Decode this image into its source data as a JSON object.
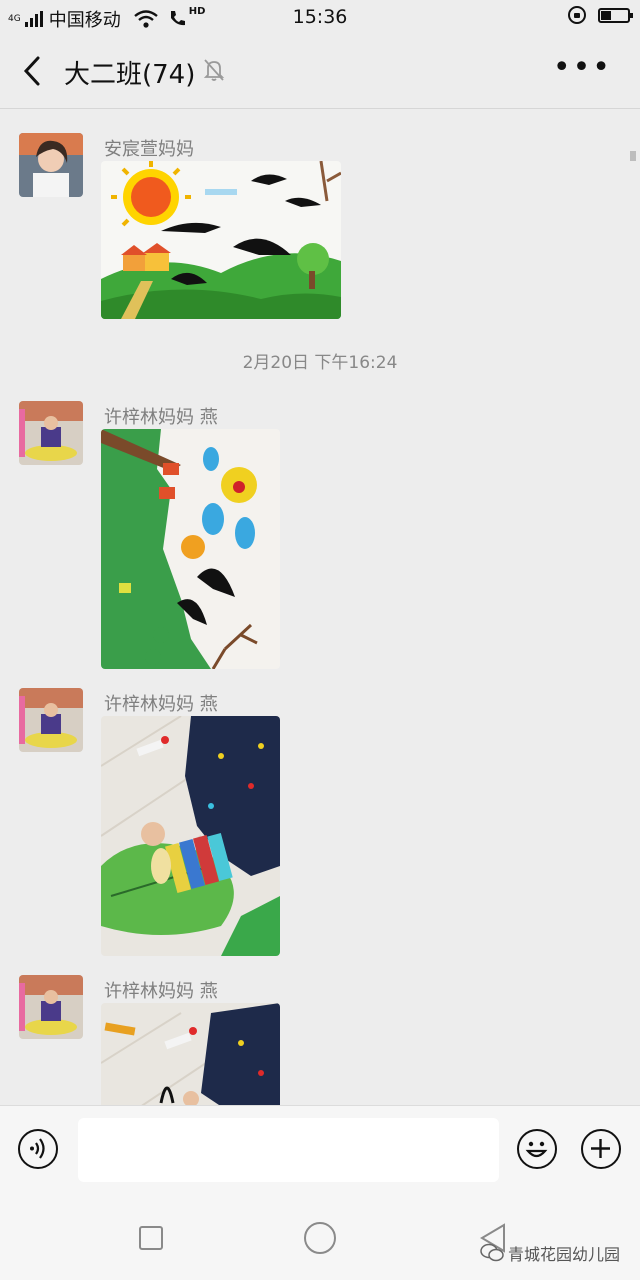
{
  "status": {
    "network": "4G",
    "carrier": "中国移动",
    "hd": "HD",
    "time": "15:36",
    "battery_level": 0.35
  },
  "header": {
    "title": "大二班(74)",
    "icons": [
      "back-arrow-icon",
      "mute-bell-icon",
      "more-dots-icon"
    ]
  },
  "messages": [
    {
      "sender": "安宸萱妈妈",
      "image": "children-drawing-sun-swallows"
    },
    {
      "timestamp": "2月20日 下午16:24"
    },
    {
      "sender": "许梓林妈妈 燕",
      "image": "children-drawing-swallows-tree"
    },
    {
      "sender": "许梓林妈妈 燕",
      "image": "photo-child-leaf-craft"
    },
    {
      "sender": "许梓林妈妈 燕",
      "image": "photo-child-craft-partial"
    }
  ],
  "input_bar": {
    "icons": [
      "voice-icon",
      "emoji-icon",
      "plus-icon"
    ]
  },
  "watermark": "青城花园幼儿园"
}
